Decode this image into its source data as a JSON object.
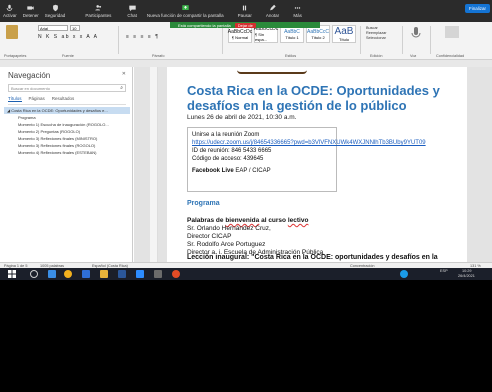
{
  "colors": {
    "accent": "#2e74b5",
    "zoom_bar": "#2b2b2b",
    "share_green": "#2a8a3a",
    "stop_red": "#d32f2f"
  },
  "zoom_bar": {
    "items": [
      "Activar",
      "Detener",
      "Seguridad",
      "Participantes",
      "Chat",
      "Nueva función de compartir la pantalla",
      "Pausar",
      "Anotar",
      "Más"
    ],
    "leave_label": "Finalizar"
  },
  "share_bar": {
    "text": "Está compartiendo la pantalla",
    "stop_label": "Dejar de"
  },
  "ribbon": {
    "font_name": "Arial",
    "font_size": "10",
    "groups": [
      "Portapapeles",
      "Fuente",
      "Párrafo",
      "Estilos",
      "Edición",
      "Voz",
      "Confidencialidad"
    ],
    "styles": [
      {
        "preview": "AaBbCcDc",
        "name": "¶ Normal"
      },
      {
        "preview": "AaBbCcDc",
        "name": "¶ Sin espa..."
      },
      {
        "preview": "AaBbC",
        "name": "Título 1"
      },
      {
        "preview": "AaBbCcC",
        "name": "Título 2"
      },
      {
        "preview": "AaB",
        "name": "Título"
      }
    ],
    "edit_items": [
      "Buscar",
      "Reemplazar",
      "Seleccionar"
    ]
  },
  "navigation": {
    "title": "Navegación",
    "search_placeholder": "Buscar en documento",
    "tabs": [
      "Títulos",
      "Páginas",
      "Resultados"
    ],
    "items": [
      {
        "label": "Costa Rica en la OCDE: Oportunidades y desafíos e...",
        "selected": true
      },
      {
        "label": "Programa",
        "selected": false
      },
      {
        "label": "Momento 1) Escucha de inauguración (ROGOLO...",
        "selected": false
      },
      {
        "label": "Momento 2) Preguntas (ROGOLO)",
        "selected": false
      },
      {
        "label": "Momento 3) Reflexiones finales (MINISTRO)",
        "selected": false
      },
      {
        "label": "Momento 3) Reflexiones finales (ROGOLO)",
        "selected": false
      },
      {
        "label": "Momento 4) Reflexiones finales (ESTEBAN)",
        "selected": false
      }
    ]
  },
  "document": {
    "title": "Costa Rica en la OCDE: Oportunidades y desafíos en la gestión de lo público",
    "date": "Lunes 26 de abril de 2021, 10:30 a.m.",
    "zoom_box": {
      "line1": "Unirse a la reunión Zoom",
      "link": "https://udecr.zoom.us/j/84654336665?pwd=b3VlVFNXUWk4WXJNNlhTb3BUby9YUT09",
      "meeting_id": "ID de reunión: 846 5433 6665",
      "access_code": "Código de acceso: 439645",
      "facebook_bold": "Facebook Live",
      "facebook_rest": " EAP / CICAP"
    },
    "section": "Programa",
    "body": {
      "p1_a": "Palabras de ",
      "p1_b": "bienvenida",
      "p1_c": " al curso ",
      "p1_d": "lectivo",
      "l2": "Sr. Orlando Hernández Cruz,",
      "l3": "Director CICAP",
      "l4": "Sr. Rodolfo Arce Portuguez",
      "l5": "Director a. i. Escuela de Administración Pública"
    },
    "lecture": "Lección inaugural: \"Costa Rica en la OCDE: oportunidades y desafíos en la"
  },
  "status_bar": {
    "page": "Página 1 de 5",
    "words": "1005 palabras",
    "language": "Español (Costa Rica)",
    "focus": "Concentración",
    "zoom": "131 %"
  },
  "taskbar": {
    "time": "10:29",
    "date": "26/4/2021",
    "lang": "ESP"
  }
}
